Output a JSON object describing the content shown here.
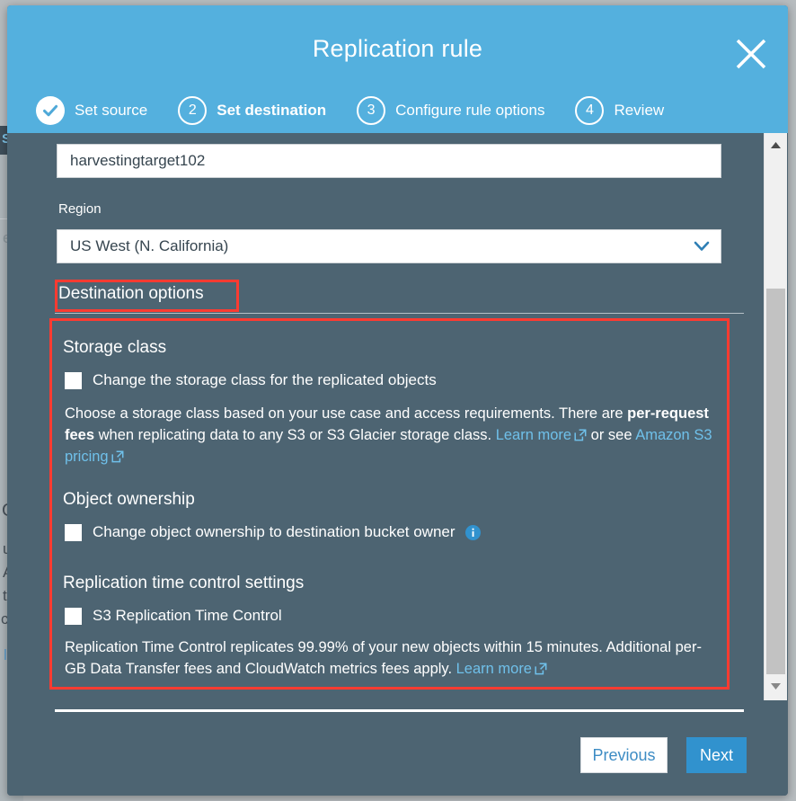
{
  "modal": {
    "title": "Replication rule",
    "close_icon": "close-icon",
    "steps": [
      {
        "marker": "✓",
        "label": "Set source",
        "state": "done"
      },
      {
        "marker": "2",
        "label": "Set destination",
        "state": "current"
      },
      {
        "marker": "3",
        "label": "Configure rule options",
        "state": "upcoming"
      },
      {
        "marker": "4",
        "label": "Review",
        "state": "upcoming"
      }
    ]
  },
  "form": {
    "bucket_value": "harvestingtarget102",
    "bucket_placeholder": "harvestingtarget102",
    "region_label": "Region",
    "region_value": "US West (N. California)",
    "region_chevron": "chevron-down-icon"
  },
  "destination_options": {
    "heading": "Destination options",
    "storage_class": {
      "title": "Storage class",
      "checkbox_label": "Change the storage class for the replicated objects",
      "checked": false,
      "desc_part1": "Choose a storage class based on your use case and access requirements. There are ",
      "desc_bold1": "per-request fees",
      "desc_part2": " when replicating data to any S3 or S3 Glacier storage class. ",
      "link1": "Learn more",
      "desc_part3": " or see ",
      "link2": "Amazon S3 pricing"
    },
    "object_ownership": {
      "title": "Object ownership",
      "checkbox_label": "Change object ownership to destination bucket owner",
      "checked": false,
      "info_icon": "info-icon"
    },
    "replication_time_control": {
      "title": "Replication time control settings",
      "checkbox_label": "S3 Replication Time Control",
      "checked": false,
      "desc_part1": "Replication Time Control replicates 99.99% of your new objects within 15 minutes. Additional per-GB Data Transfer fees and CloudWatch metrics fees apply. ",
      "link1": "Learn more"
    }
  },
  "footer": {
    "previous_label": "Previous",
    "next_label": "Next"
  },
  "scrollbar": {
    "up_icon": "scroll-up-arrow-icon",
    "down_icon": "scroll-down-arrow-icon"
  },
  "background_page": {
    "fragment_s": "S",
    "fragment_e": "e",
    "fragment_o": "O",
    "fragment_u": "u",
    "fragment_a": "A",
    "fragment_t": "t",
    "fragment_c": "c",
    "fragment_i": "l"
  },
  "colors": {
    "header_blue": "#54b0de",
    "modal_body": "#4d6472",
    "accent_link": "#6fc0ea",
    "highlight_red": "#fc3b31",
    "next_button": "#3192ce"
  }
}
